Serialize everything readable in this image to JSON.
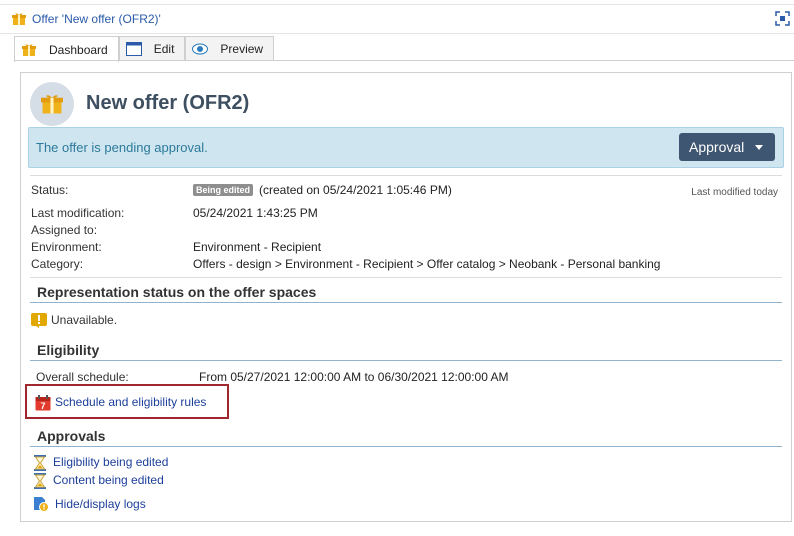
{
  "window": {
    "title": "Offer 'New offer (OFR2)'"
  },
  "tabs": [
    {
      "label": "Dashboard",
      "icon": "gift-icon",
      "active": true
    },
    {
      "label": "Edit",
      "icon": "window-icon",
      "active": false
    },
    {
      "label": "Preview",
      "icon": "eye-icon",
      "active": false
    }
  ],
  "header": {
    "title": "New offer (OFR2)"
  },
  "banner": {
    "message": "The offer is pending approval.",
    "button_label": "Approval"
  },
  "details": {
    "status_label": "Status:",
    "status_badge": "Being edited",
    "status_text": "(created on 05/24/2021 1:05:46 PM)",
    "last_modified_note": "Last modified today",
    "last_modification_label": "Last modification:",
    "last_modification_value": "05/24/2021 1:43:25 PM",
    "assigned_label": "Assigned to:",
    "environment_label": "Environment:",
    "environment_value": "Environment - Recipient",
    "category_label": "Category:",
    "category_value": "Offers - design > Environment - Recipient > Offer catalog > Neobank - Personal banking"
  },
  "representation": {
    "heading": "Representation status on the offer spaces",
    "status": "Unavailable."
  },
  "eligibility": {
    "heading": "Eligibility",
    "schedule_label": "Overall schedule:",
    "schedule_value": "From 05/27/2021 12:00:00 AM to 06/30/2021 12:00:00 AM",
    "rules_link": "Schedule and eligibility rules"
  },
  "approvals": {
    "heading": "Approvals",
    "items": [
      "Eligibility being edited",
      "Content being edited"
    ],
    "logs_link": "Hide/display logs"
  },
  "colors": {
    "accent": "#3e5671",
    "link": "#1c3f9a",
    "banner_bg": "#cfe6f0",
    "highlight": "#a0272d"
  }
}
